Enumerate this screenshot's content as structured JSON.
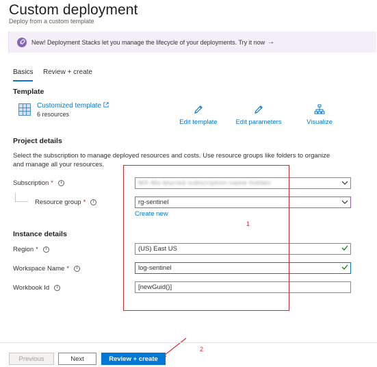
{
  "header": {
    "title": "Custom deployment",
    "more": "···",
    "subtitle": "Deploy from a custom template"
  },
  "banner": {
    "text": "New! Deployment Stacks let you manage the lifecycle of your deployments. Try it now",
    "arrow": "→"
  },
  "tabs": [
    {
      "label": "Basics",
      "selected": true
    },
    {
      "label": "Review + create",
      "selected": false
    }
  ],
  "template": {
    "heading": "Template",
    "link": "Customized template",
    "count": "6 resources",
    "actions": {
      "edit_template": "Edit template",
      "edit_parameters": "Edit parameters",
      "visualize": "Visualize"
    }
  },
  "project": {
    "heading": "Project details",
    "description": "Select the subscription to manage deployed resources and costs. Use resource groups like folders to organize and manage all your resources.",
    "subscription_label": "Subscription",
    "subscription_value": "MX-Ms-blurred-subscription-name-hidden",
    "resource_group_label": "Resource group",
    "resource_group_value": "rg-sentinel",
    "create_new": "Create new"
  },
  "instance": {
    "heading": "Instance details",
    "region_label": "Region",
    "region_value": "(US) East US",
    "workspace_label": "Workspace Name",
    "workspace_value": "log-sentinel",
    "workbook_label": "Workbook Id",
    "workbook_value": "[newGuid()]"
  },
  "annotations": {
    "box_number": "1",
    "arrow_number": "2"
  },
  "footer": {
    "previous": "Previous",
    "next": "Next",
    "review_create": "Review + create"
  },
  "colors": {
    "accent": "#0078d4",
    "required": "#a4262c",
    "valid": "#107c10",
    "annotation": "#e8212b",
    "banner_bg": "#f4eef9"
  }
}
